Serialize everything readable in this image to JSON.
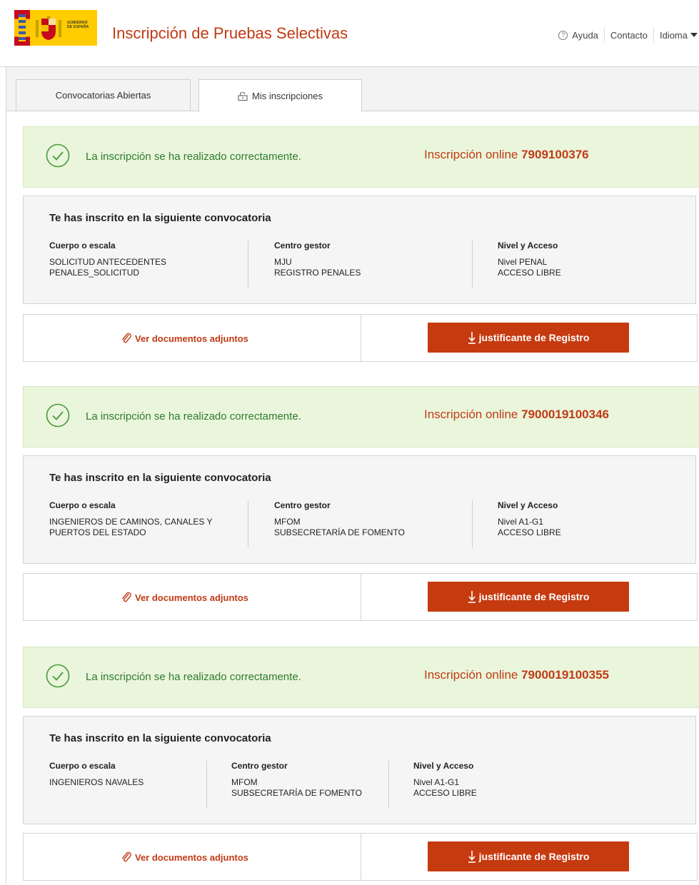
{
  "header": {
    "title": "Inscripción de Pruebas Selectivas",
    "logo_text_1": "GOBIERNO",
    "logo_text_2": "DE ESPAÑA",
    "help_label": "Ayuda",
    "contact_label": "Contacto",
    "language_label": "Idioma"
  },
  "tabs": [
    {
      "label": "Convocatorias Abiertas"
    },
    {
      "label": "Mis inscripciones"
    }
  ],
  "inscriptions": [
    {
      "success_message": "La inscripción se ha realizado correctamente.",
      "online_label": "Inscripción online",
      "number": "7909100376",
      "detail_title": "Te has inscrito en la siguiente convocatoria",
      "cuerpo_header": "Cuerpo o escala",
      "cuerpo_line1": "SOLICITUD ANTECEDENTES",
      "cuerpo_line2": "PENALES_SOLICITUD",
      "centro_header": "Centro gestor",
      "centro_line1": "MJU",
      "centro_line2": "REGISTRO PENALES",
      "nivel_header": "Nivel y Acceso",
      "nivel_line1": "Nivel PENAL",
      "nivel_line2": "ACCESO LIBRE",
      "docs_label": "Ver documentos adjuntos",
      "download_label": "justificante de Registro"
    },
    {
      "success_message": "La inscripción se ha realizado correctamente.",
      "online_label": "Inscripción online",
      "number": "7900019100346",
      "detail_title": "Te has inscrito en la siguiente convocatoria",
      "cuerpo_header": "Cuerpo o escala",
      "cuerpo_line1": "INGENIEROS DE CAMINOS, CANALES Y",
      "cuerpo_line2": "PUERTOS DEL ESTADO",
      "centro_header": "Centro gestor",
      "centro_line1": "MFOM",
      "centro_line2": "SUBSECRETARÍA DE FOMENTO",
      "nivel_header": "Nivel y Acceso",
      "nivel_line1": "Nivel A1-G1",
      "nivel_line2": "ACCESO LIBRE",
      "docs_label": "Ver documentos adjuntos",
      "download_label": "justificante de Registro"
    },
    {
      "success_message": "La inscripción se ha realizado correctamente.",
      "online_label": "Inscripción online",
      "number": "7900019100355",
      "detail_title": "Te has inscrito en la siguiente convocatoria",
      "cuerpo_header": "Cuerpo o escala",
      "cuerpo_line1": "INGENIEROS NAVALES",
      "cuerpo_line2": "",
      "centro_header": "Centro gestor",
      "centro_line1": "MFOM",
      "centro_line2": "SUBSECRETARÍA DE FOMENTO",
      "nivel_header": "Nivel y Acceso",
      "nivel_line1": "Nivel A1-G1",
      "nivel_line2": "ACCESO LIBRE",
      "docs_label": "Ver documentos adjuntos",
      "download_label": "justificante de Registro"
    }
  ],
  "colors": {
    "brand": "#c13a14",
    "button": "#c63a10",
    "success_bg": "#eaf6dc",
    "success_text": "#2f7a2f"
  },
  "icons": {
    "help": "help-circle-icon",
    "lock": "lock-icon",
    "check": "check-circle-icon",
    "clip": "paperclip-icon",
    "download": "download-arrow-icon",
    "caret": "caret-down-icon"
  }
}
